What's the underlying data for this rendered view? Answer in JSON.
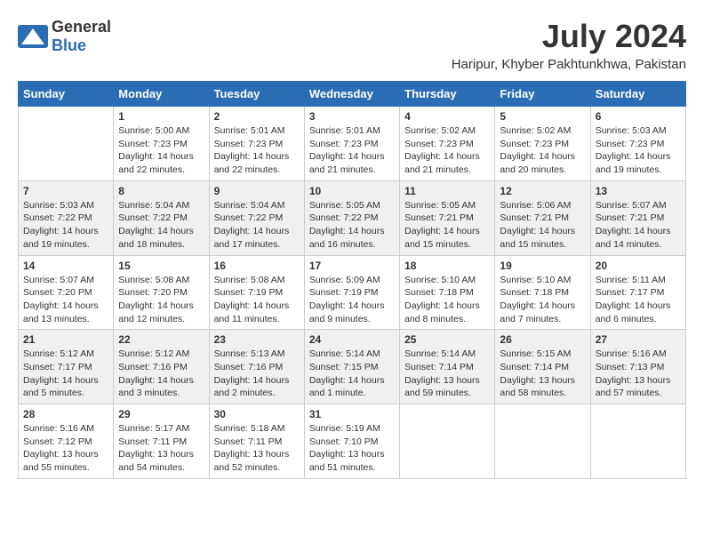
{
  "header": {
    "logo_general": "General",
    "logo_blue": "Blue",
    "month_year": "July 2024",
    "location": "Haripur, Khyber Pakhtunkhwa, Pakistan"
  },
  "days_of_week": [
    "Sunday",
    "Monday",
    "Tuesday",
    "Wednesday",
    "Thursday",
    "Friday",
    "Saturday"
  ],
  "weeks": [
    [
      {
        "day": "",
        "info": ""
      },
      {
        "day": "1",
        "info": "Sunrise: 5:00 AM\nSunset: 7:23 PM\nDaylight: 14 hours\nand 22 minutes."
      },
      {
        "day": "2",
        "info": "Sunrise: 5:01 AM\nSunset: 7:23 PM\nDaylight: 14 hours\nand 22 minutes."
      },
      {
        "day": "3",
        "info": "Sunrise: 5:01 AM\nSunset: 7:23 PM\nDaylight: 14 hours\nand 21 minutes."
      },
      {
        "day": "4",
        "info": "Sunrise: 5:02 AM\nSunset: 7:23 PM\nDaylight: 14 hours\nand 21 minutes."
      },
      {
        "day": "5",
        "info": "Sunrise: 5:02 AM\nSunset: 7:23 PM\nDaylight: 14 hours\nand 20 minutes."
      },
      {
        "day": "6",
        "info": "Sunrise: 5:03 AM\nSunset: 7:23 PM\nDaylight: 14 hours\nand 19 minutes."
      }
    ],
    [
      {
        "day": "7",
        "info": "Sunrise: 5:03 AM\nSunset: 7:22 PM\nDaylight: 14 hours\nand 19 minutes."
      },
      {
        "day": "8",
        "info": "Sunrise: 5:04 AM\nSunset: 7:22 PM\nDaylight: 14 hours\nand 18 minutes."
      },
      {
        "day": "9",
        "info": "Sunrise: 5:04 AM\nSunset: 7:22 PM\nDaylight: 14 hours\nand 17 minutes."
      },
      {
        "day": "10",
        "info": "Sunrise: 5:05 AM\nSunset: 7:22 PM\nDaylight: 14 hours\nand 16 minutes."
      },
      {
        "day": "11",
        "info": "Sunrise: 5:05 AM\nSunset: 7:21 PM\nDaylight: 14 hours\nand 15 minutes."
      },
      {
        "day": "12",
        "info": "Sunrise: 5:06 AM\nSunset: 7:21 PM\nDaylight: 14 hours\nand 15 minutes."
      },
      {
        "day": "13",
        "info": "Sunrise: 5:07 AM\nSunset: 7:21 PM\nDaylight: 14 hours\nand 14 minutes."
      }
    ],
    [
      {
        "day": "14",
        "info": "Sunrise: 5:07 AM\nSunset: 7:20 PM\nDaylight: 14 hours\nand 13 minutes."
      },
      {
        "day": "15",
        "info": "Sunrise: 5:08 AM\nSunset: 7:20 PM\nDaylight: 14 hours\nand 12 minutes."
      },
      {
        "day": "16",
        "info": "Sunrise: 5:08 AM\nSunset: 7:19 PM\nDaylight: 14 hours\nand 11 minutes."
      },
      {
        "day": "17",
        "info": "Sunrise: 5:09 AM\nSunset: 7:19 PM\nDaylight: 14 hours\nand 9 minutes."
      },
      {
        "day": "18",
        "info": "Sunrise: 5:10 AM\nSunset: 7:18 PM\nDaylight: 14 hours\nand 8 minutes."
      },
      {
        "day": "19",
        "info": "Sunrise: 5:10 AM\nSunset: 7:18 PM\nDaylight: 14 hours\nand 7 minutes."
      },
      {
        "day": "20",
        "info": "Sunrise: 5:11 AM\nSunset: 7:17 PM\nDaylight: 14 hours\nand 6 minutes."
      }
    ],
    [
      {
        "day": "21",
        "info": "Sunrise: 5:12 AM\nSunset: 7:17 PM\nDaylight: 14 hours\nand 5 minutes."
      },
      {
        "day": "22",
        "info": "Sunrise: 5:12 AM\nSunset: 7:16 PM\nDaylight: 14 hours\nand 3 minutes."
      },
      {
        "day": "23",
        "info": "Sunrise: 5:13 AM\nSunset: 7:16 PM\nDaylight: 14 hours\nand 2 minutes."
      },
      {
        "day": "24",
        "info": "Sunrise: 5:14 AM\nSunset: 7:15 PM\nDaylight: 14 hours\nand 1 minute."
      },
      {
        "day": "25",
        "info": "Sunrise: 5:14 AM\nSunset: 7:14 PM\nDaylight: 13 hours\nand 59 minutes."
      },
      {
        "day": "26",
        "info": "Sunrise: 5:15 AM\nSunset: 7:14 PM\nDaylight: 13 hours\nand 58 minutes."
      },
      {
        "day": "27",
        "info": "Sunrise: 5:16 AM\nSunset: 7:13 PM\nDaylight: 13 hours\nand 57 minutes."
      }
    ],
    [
      {
        "day": "28",
        "info": "Sunrise: 5:16 AM\nSunset: 7:12 PM\nDaylight: 13 hours\nand 55 minutes."
      },
      {
        "day": "29",
        "info": "Sunrise: 5:17 AM\nSunset: 7:11 PM\nDaylight: 13 hours\nand 54 minutes."
      },
      {
        "day": "30",
        "info": "Sunrise: 5:18 AM\nSunset: 7:11 PM\nDaylight: 13 hours\nand 52 minutes."
      },
      {
        "day": "31",
        "info": "Sunrise: 5:19 AM\nSunset: 7:10 PM\nDaylight: 13 hours\nand 51 minutes."
      },
      {
        "day": "",
        "info": ""
      },
      {
        "day": "",
        "info": ""
      },
      {
        "day": "",
        "info": ""
      }
    ]
  ]
}
